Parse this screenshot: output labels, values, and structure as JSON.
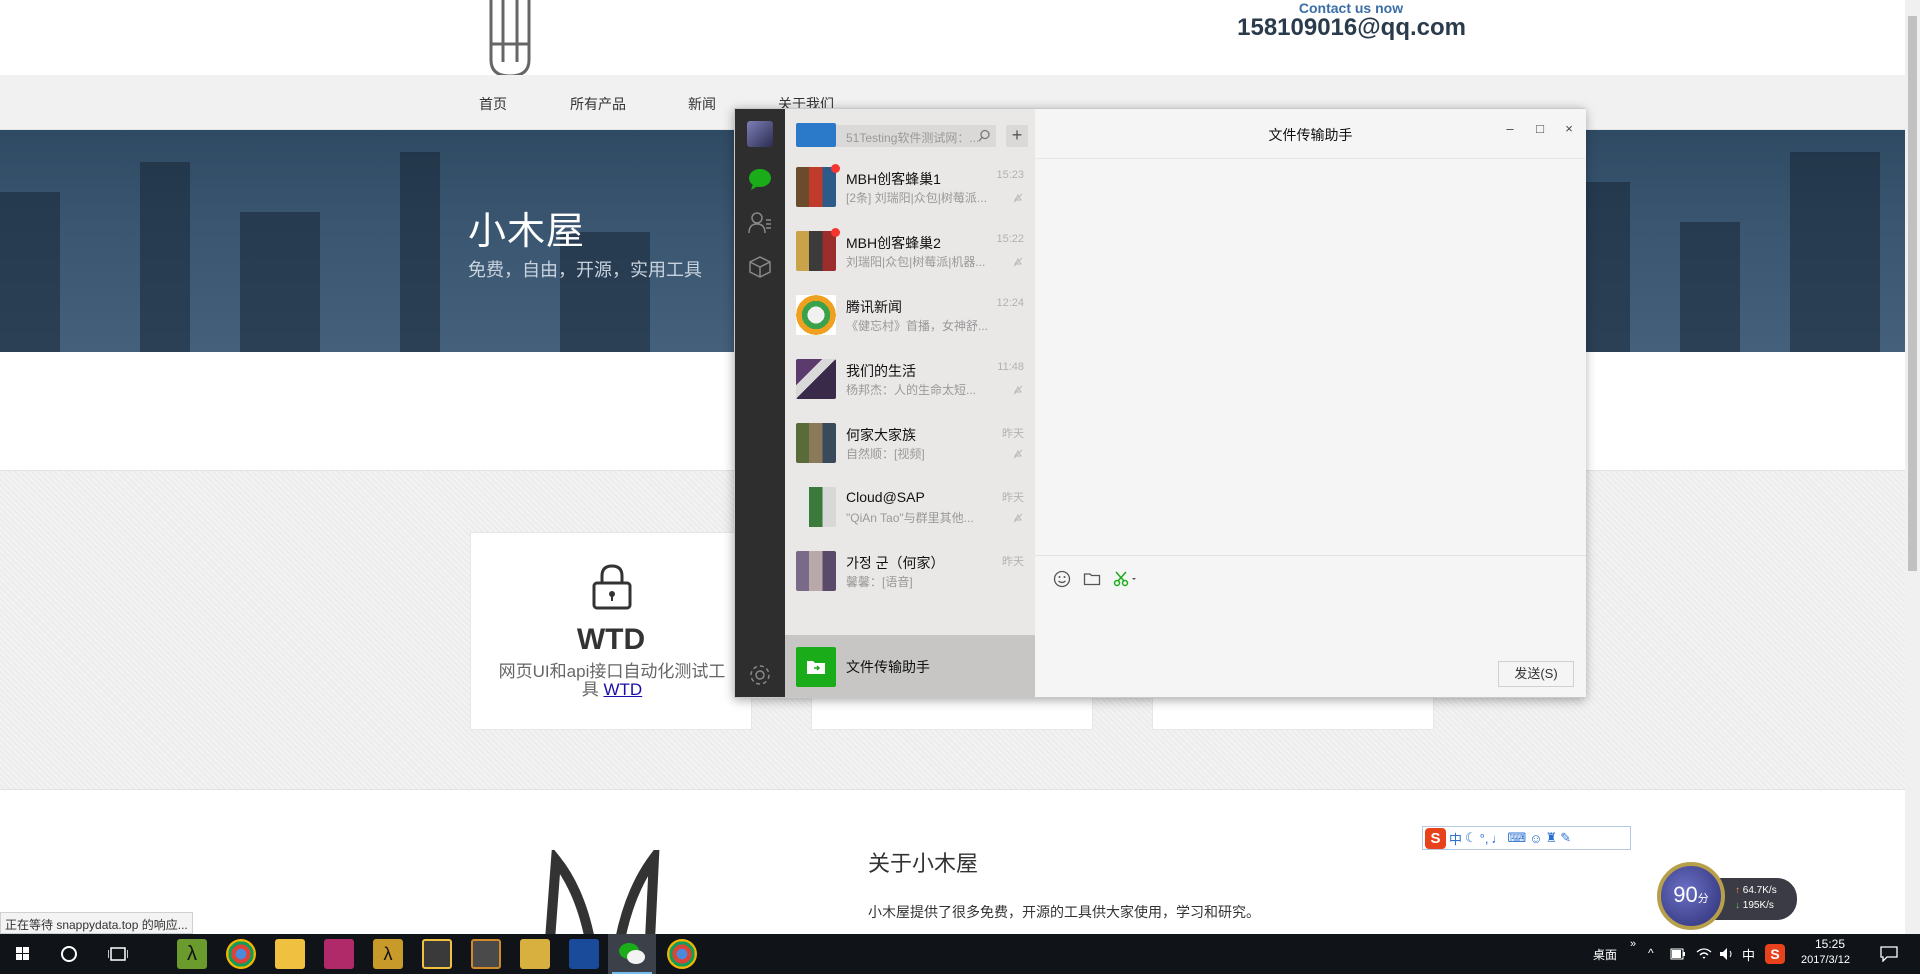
{
  "site": {
    "contact_label": "Contact us now",
    "contact_email": "158109016@qq.com",
    "nav": [
      "首页",
      "所有产品",
      "新闻",
      "关于我们"
    ],
    "hero_title": "小木屋",
    "hero_subtitle": "免费，自由，开源，实用工具",
    "card": {
      "title": "WTD",
      "desc": "网页UI和api接口自动化测试工具",
      "link": "WTD"
    },
    "about_title": "关于小木屋",
    "about_text": "小木屋提供了很多免费，开源的工具供大家使用，学习和研究。",
    "status_text": "正在等待 snappydata.top 的响应..."
  },
  "ime": {
    "logo": "S",
    "mode": "中"
  },
  "speed_widget": {
    "score": "90",
    "unit": "分",
    "upload": "64.7K/s",
    "download": "195K/s"
  },
  "wechat": {
    "search_placeholder": "搜索",
    "add_label": "+",
    "chat_title": "文件传输助手",
    "send_label": "发送(S)",
    "conversations": [
      {
        "name": "51Testing软件测试网",
        "msg": "51Testing软件测试网：...",
        "time": ""
      },
      {
        "name": "MBH创客蜂巢1",
        "msg": "[2条] 刘瑞阳|众包|树莓派...",
        "time": "15:23"
      },
      {
        "name": "MBH创客蜂巢2",
        "msg": "刘瑞阳|众包|树莓派|机器...",
        "time": "15:22"
      },
      {
        "name": "腾讯新闻",
        "msg": "《健忘村》首播，女神舒...",
        "time": "12:24"
      },
      {
        "name": "我们的生活",
        "msg": "杨邦杰：人的生命太短...",
        "time": "11:48"
      },
      {
        "name": "何家大家族",
        "msg": "自然顺：[视频]",
        "time": "昨天"
      },
      {
        "name": "Cloud@SAP",
        "msg": "\"QiAn Tao\"与群里其他...",
        "time": "昨天"
      },
      {
        "name": "가정 군（何家）",
        "msg": "馨馨：[语音]",
        "time": "昨天"
      },
      {
        "name": "文件传输助手",
        "msg": "",
        "time": ""
      }
    ]
  },
  "taskbar": {
    "desktop_label": "桌面",
    "ime_label": "中",
    "time": "15:25",
    "date": "2017/3/12"
  },
  "colors": {
    "wechat_green": "#1aad19",
    "hero_blue": "#3a5670",
    "taskbar": "#101418"
  }
}
